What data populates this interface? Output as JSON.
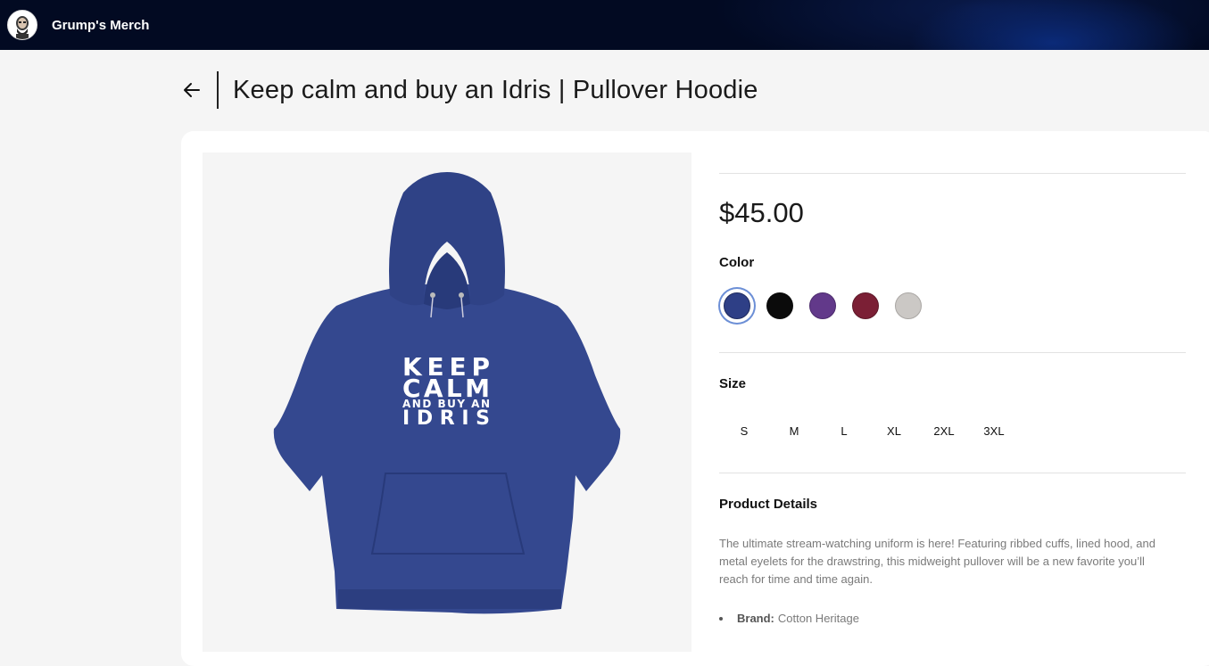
{
  "header": {
    "brand": "Grump's Merch"
  },
  "product": {
    "title": "Keep calm and buy an Idris | Pullover Hoodie",
    "price": "$45.00",
    "print_lines": [
      "KEEP",
      "CALM",
      "AND BUY AN",
      "IDRIS"
    ],
    "color_label": "Color",
    "colors": [
      {
        "name": "navy",
        "hex": "#2e3f86",
        "selected": true
      },
      {
        "name": "black",
        "hex": "#0b0b0b",
        "selected": false
      },
      {
        "name": "purple",
        "hex": "#62398a",
        "selected": false
      },
      {
        "name": "maroon",
        "hex": "#7b1f35",
        "selected": false
      },
      {
        "name": "gray",
        "hex": "#cbc8c5",
        "selected": false
      }
    ],
    "size_label": "Size",
    "sizes": [
      "S",
      "M",
      "L",
      "XL",
      "2XL",
      "3XL"
    ],
    "details_label": "Product Details",
    "description": "The ultimate stream-watching uniform is here! Featuring ribbed cuffs, lined hood, and metal eyelets for the drawstring, this midweight pullover will be a new favorite you’ll reach for time and time again.",
    "brand_label": "Brand:",
    "brand_value": "Cotton Heritage"
  },
  "colors": {
    "hoodie": "#34488f",
    "topbar": "#020a22"
  }
}
